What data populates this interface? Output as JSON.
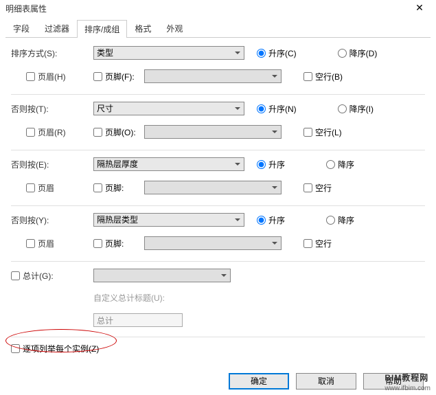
{
  "window": {
    "title": "明细表属性"
  },
  "tabs": [
    "字段",
    "过滤器",
    "排序/成组",
    "格式",
    "外观"
  ],
  "active_tab": 2,
  "groups": [
    {
      "label": "排序方式(S):",
      "select": "类型",
      "select_enabled": true,
      "asc": "升序(C)",
      "desc": "降序(D)",
      "selected": "asc",
      "header": "页眉(H)",
      "footer": "页脚(F):",
      "footer_select": "",
      "blank": "空行(B)"
    },
    {
      "label": "否则按(T):",
      "select": "尺寸",
      "select_enabled": true,
      "asc": "升序(N)",
      "desc": "降序(I)",
      "selected": "asc",
      "header": "页眉(R)",
      "footer": "页脚(O):",
      "footer_select": "",
      "blank": "空行(L)"
    },
    {
      "label": "否则按(E):",
      "select": "隔热层厚度",
      "select_enabled": true,
      "asc": "升序",
      "desc": "降序",
      "selected": "asc",
      "header": "页眉",
      "footer": "页脚:",
      "footer_select": "",
      "blank": "空行"
    },
    {
      "label": "否则按(Y):",
      "select": "隔热层类型",
      "select_enabled": true,
      "asc": "升序",
      "desc": "降序",
      "selected": "asc",
      "header": "页眉",
      "footer": "页脚:",
      "footer_select": "",
      "blank": "空行"
    }
  ],
  "grand_total": {
    "label": "总计(G):",
    "select": "",
    "custom_label": "自定义总计标题(U):",
    "custom_value": "总计"
  },
  "itemize": "逐项列举每个实例(Z)",
  "buttons": {
    "ok": "确定",
    "cancel": "取消",
    "help": "帮助"
  },
  "watermark": {
    "big": "BIM教程网",
    "small": "www.ifbim.com"
  }
}
